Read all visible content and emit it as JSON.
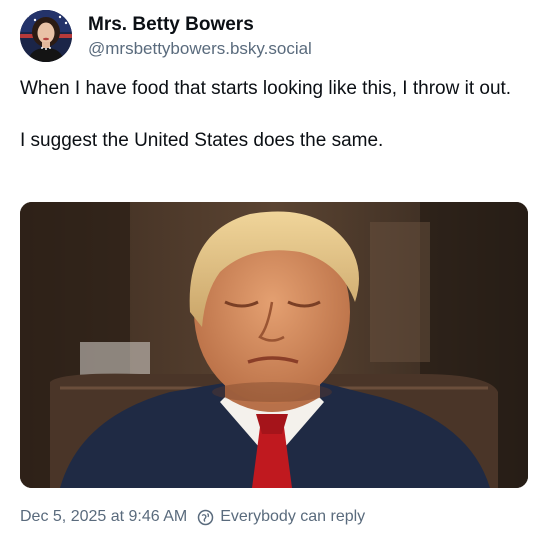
{
  "author": {
    "display_name": "Mrs. Betty Bowers",
    "handle": "@mrsbettybowers.bsky.social",
    "avatar_icon": "profile-avatar"
  },
  "post": {
    "paragraphs": [
      "When I have food that starts looking like this, I throw it out.",
      "I suggest the United States does the same."
    ],
    "image_alt_icon": "photo-image"
  },
  "footer": {
    "timestamp": "Dec 5, 2025 at 9:46 AM",
    "reply_setting": "Everybody can reply",
    "reply_icon": "globe-icon"
  },
  "colors": {
    "text_primary": "#0b0f14",
    "text_secondary": "#5a6b7d",
    "background": "#ffffff"
  }
}
